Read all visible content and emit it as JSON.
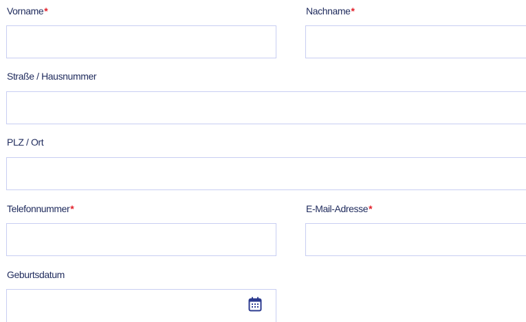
{
  "colors": {
    "label": "#1e2a5c",
    "required_marker": "#e2202a",
    "field_border": "#c7cdf2",
    "icon": "#2b3a8f"
  },
  "required_marker": "*",
  "form": {
    "vorname": {
      "label": "Vorname",
      "required": true,
      "value": ""
    },
    "nachname": {
      "label": "Nachname",
      "required": true,
      "value": ""
    },
    "strasse": {
      "label": "Straße / Hausnummer",
      "required": false,
      "value": ""
    },
    "plz_ort": {
      "label": "PLZ / Ort",
      "required": false,
      "value": ""
    },
    "telefon": {
      "label": "Telefonnummer",
      "required": true,
      "value": ""
    },
    "email": {
      "label": "E-Mail-Adresse",
      "required": true,
      "value": ""
    },
    "geburtsdatum": {
      "label": "Geburtsdatum",
      "required": false,
      "value": "",
      "icon": "calendar-icon"
    }
  }
}
